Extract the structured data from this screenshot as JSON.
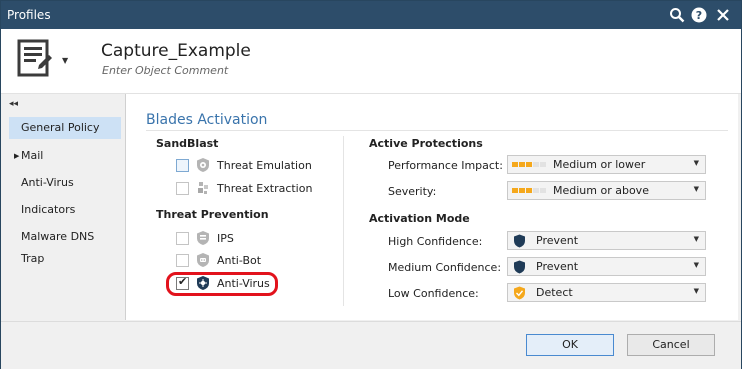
{
  "window": {
    "title": "Profiles"
  },
  "object": {
    "name": "Capture_Example",
    "comment_placeholder": "Enter Object Comment"
  },
  "sidebar": {
    "items": [
      {
        "label": "General Policy",
        "active": true
      },
      {
        "label": "Mail",
        "expandable": true
      },
      {
        "label": "Anti-Virus"
      },
      {
        "label": "Indicators"
      },
      {
        "label": "Malware DNS Trap"
      }
    ]
  },
  "blades": {
    "title": "Blades Activation",
    "sandblast": {
      "label": "SandBlast",
      "items": [
        {
          "label": "Threat Emulation",
          "checked": false,
          "icon": "threat-emulation-icon"
        },
        {
          "label": "Threat Extraction",
          "checked": false,
          "icon": "threat-extraction-icon"
        }
      ]
    },
    "threat_prevention": {
      "label": "Threat Prevention",
      "items": [
        {
          "label": "IPS",
          "checked": false,
          "icon": "ips-icon"
        },
        {
          "label": "Anti-Bot",
          "checked": false,
          "icon": "anti-bot-icon"
        },
        {
          "label": "Anti-Virus",
          "checked": true,
          "icon": "anti-virus-icon"
        }
      ]
    }
  },
  "active_protections": {
    "label": "Active Protections",
    "performance_impact": {
      "label": "Performance Impact:",
      "value": "Medium or lower",
      "level": 0.5
    },
    "severity": {
      "label": "Severity:",
      "value": "Medium or above",
      "level": 0.5
    }
  },
  "activation_mode": {
    "label": "Activation Mode",
    "high": {
      "label": "High Confidence:",
      "value": "Prevent"
    },
    "medium": {
      "label": "Medium Confidence:",
      "value": "Prevent"
    },
    "low": {
      "label": "Low Confidence:",
      "value": "Detect"
    }
  },
  "buttons": {
    "ok": "OK",
    "cancel": "Cancel"
  },
  "colors": {
    "titlebar": "#2d4d6a",
    "section_title": "#3a74ac",
    "highlight": "#e2121c",
    "meter_on": "#f5a81c",
    "meter_off": "#e2e2e2",
    "prevent_shield": "#1f3b57",
    "detect_shield": "#f5a81c"
  }
}
